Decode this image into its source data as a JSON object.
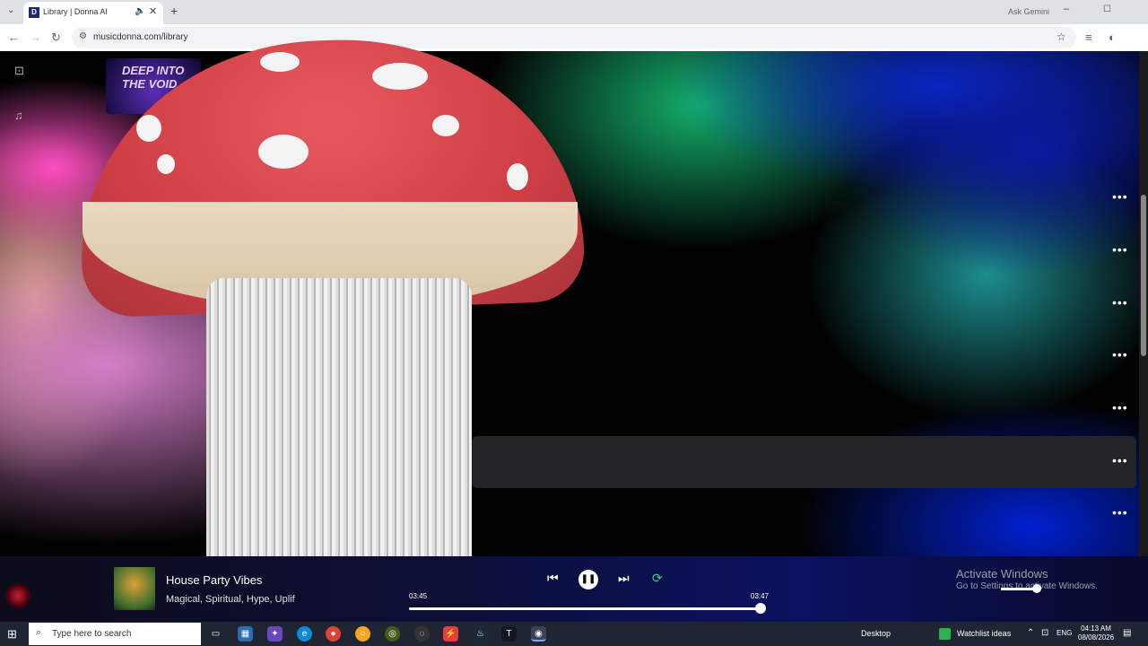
{
  "browser": {
    "tab_title": "Library | Donna AI",
    "url": "musicdonna.com/library",
    "gemini_label": "Ask Gemini"
  },
  "sidebar": {
    "album_title": "DEEP INTO THE VOID"
  },
  "now_playing": {
    "title": "House Party Vibes",
    "tags": "Magical, Spiritual, Hype, Uplif",
    "current_time": "03:45",
    "duration": "03:47",
    "progress": 0.99,
    "volume": 0.85
  },
  "watermark": {
    "title": "Activate Windows",
    "subtitle": "Go to Settings to activate Windows."
  },
  "taskbar": {
    "search_placeholder": "Type here to search",
    "desktop_label": "Desktop",
    "watchlist_label": "Watchlist ideas",
    "lang": "ENG",
    "time": "04:13 AM",
    "date": "08/08/2026"
  },
  "colors": {
    "player_bg": "#0d0f38",
    "row_highlight": "#242427",
    "mushroom_cap": "#cf3e45"
  }
}
